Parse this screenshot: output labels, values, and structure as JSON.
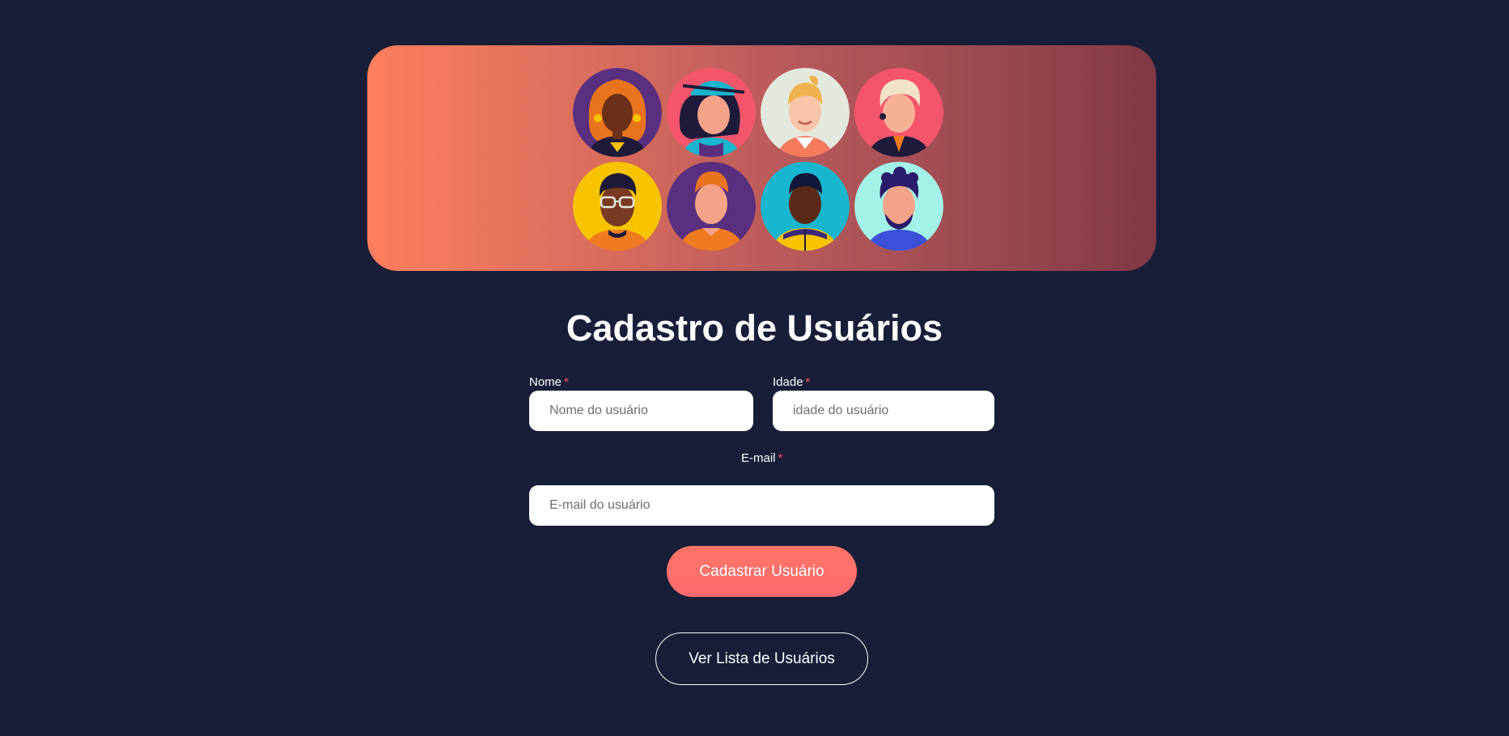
{
  "title": "Cadastro de Usuários",
  "banner": {
    "avatars": [
      {
        "name": "avatar-curly-hair-woman-icon",
        "bg": "#5a2f7f"
      },
      {
        "name": "avatar-cap-woman-icon",
        "bg": "#f5556a"
      },
      {
        "name": "avatar-blonde-woman-icon",
        "bg": "#e4e9df"
      },
      {
        "name": "avatar-white-hair-man-icon",
        "bg": "#f5556a"
      },
      {
        "name": "avatar-glasses-man-icon",
        "bg": "#f7c200"
      },
      {
        "name": "avatar-ginger-man-icon",
        "bg": "#5a2f7f"
      },
      {
        "name": "avatar-dark-man-icon",
        "bg": "#18b5cf"
      },
      {
        "name": "avatar-bearded-man-icon",
        "bg": "#a3f2e7"
      }
    ]
  },
  "form": {
    "nome": {
      "label": "Nome",
      "required_mark": "*",
      "placeholder": "Nome do usuário"
    },
    "idade": {
      "label": "Idade",
      "required_mark": "*",
      "placeholder": "idade do usuário"
    },
    "email": {
      "label": "E-mail",
      "required_mark": "*",
      "placeholder": "E-mail do usuário"
    },
    "submit_label": "Cadastrar Usuário"
  },
  "list_button_label": "Ver Lista de Usuários",
  "colors": {
    "background": "#181e37",
    "accent": "#fe6e6a",
    "required": "#ff4d5e"
  }
}
